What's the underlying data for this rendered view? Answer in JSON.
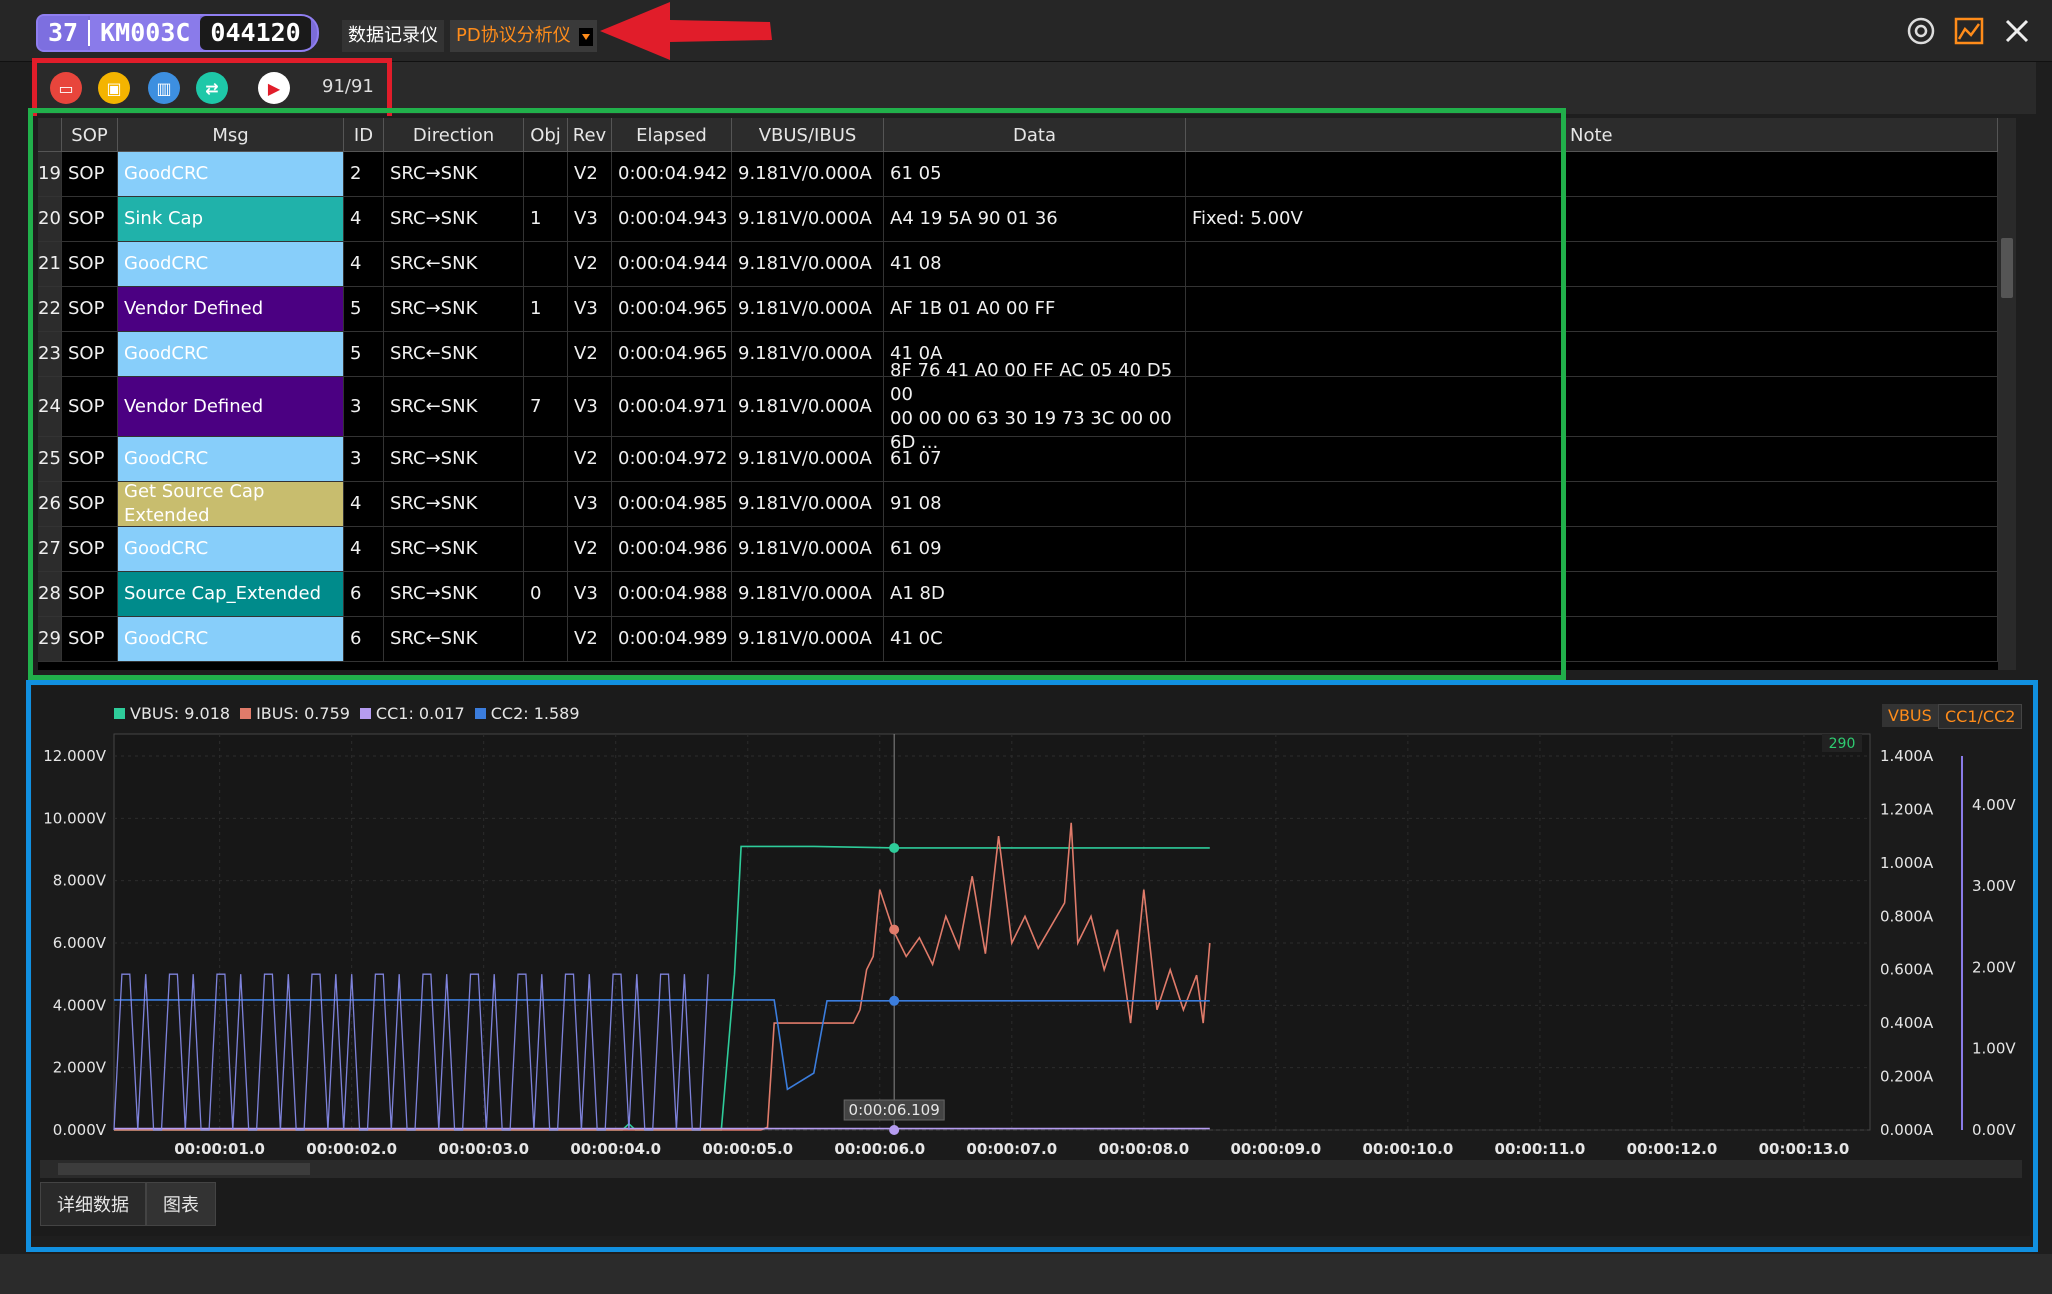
{
  "titlebar": {
    "device_num": "37",
    "device_model": "KM003C",
    "device_serial": "044120",
    "mode_tabs": [
      "数据记录仪",
      "PD协议分析仪"
    ],
    "active_mode": "PD协议分析仪"
  },
  "toolbar": {
    "buttons": [
      "open-folder-icon",
      "save-icon",
      "delete-icon",
      "sync-icon",
      "record-icon"
    ],
    "counter": "91/91"
  },
  "table": {
    "columns": [
      "SOP",
      "Msg",
      "ID",
      "Direction",
      "Obj",
      "Rev",
      "Elapsed",
      "VBUS/IBUS",
      "Data",
      "",
      "Note"
    ],
    "rows": [
      {
        "n": "19",
        "sop": "SOP",
        "msg": "GoodCRC",
        "msg_color": "#87cefa",
        "msg_text": "#ffffff",
        "id": "2",
        "dir": "SRC→SNK",
        "obj": "",
        "rev": "V2",
        "elapsed": "0:00:04.942",
        "vi": "9.181V/0.000A",
        "data": "61 05",
        "extra": "",
        "note": ""
      },
      {
        "n": "20",
        "sop": "SOP",
        "msg": "Sink Cap",
        "msg_color": "#20b2aa",
        "msg_text": "#ffffff",
        "id": "4",
        "dir": "SRC→SNK",
        "obj": "1",
        "rev": "V3",
        "elapsed": "0:00:04.943",
        "vi": "9.181V/0.000A",
        "data": "A4 19 5A 90 01 36",
        "extra": "Fixed: 5.00V",
        "note": ""
      },
      {
        "n": "21",
        "sop": "SOP",
        "msg": "GoodCRC",
        "msg_color": "#87cefa",
        "msg_text": "#ffffff",
        "id": "4",
        "dir": "SRC←SNK",
        "obj": "",
        "rev": "V2",
        "elapsed": "0:00:04.944",
        "vi": "9.181V/0.000A",
        "data": "41 08",
        "extra": "",
        "note": ""
      },
      {
        "n": "22",
        "sop": "SOP",
        "msg": "Vendor Defined",
        "msg_color": "#4b0082",
        "msg_text": "#ffffff",
        "id": "5",
        "dir": "SRC→SNK",
        "obj": "1",
        "rev": "V3",
        "elapsed": "0:00:04.965",
        "vi": "9.181V/0.000A",
        "data": "AF 1B 01 A0 00 FF",
        "extra": "",
        "note": ""
      },
      {
        "n": "23",
        "sop": "SOP",
        "msg": "GoodCRC",
        "msg_color": "#87cefa",
        "msg_text": "#ffffff",
        "id": "5",
        "dir": "SRC←SNK",
        "obj": "",
        "rev": "V2",
        "elapsed": "0:00:04.965",
        "vi": "9.181V/0.000A",
        "data": "41 0A",
        "extra": "",
        "note": ""
      },
      {
        "n": "24",
        "sop": "SOP",
        "msg": "Vendor Defined",
        "msg_color": "#4b0082",
        "msg_text": "#ffffff",
        "id": "3",
        "dir": "SRC←SNK",
        "obj": "7",
        "rev": "V3",
        "elapsed": "0:00:04.971",
        "vi": "9.181V/0.000A",
        "data": "8F 76 41 A0 00 FF AC 05 40 D5 00\n00 00 00 63 30 19 73 3C 00 00 6D ...",
        "extra": "",
        "note": ""
      },
      {
        "n": "25",
        "sop": "SOP",
        "msg": "GoodCRC",
        "msg_color": "#87cefa",
        "msg_text": "#ffffff",
        "id": "3",
        "dir": "SRC→SNK",
        "obj": "",
        "rev": "V2",
        "elapsed": "0:00:04.972",
        "vi": "9.181V/0.000A",
        "data": "61 07",
        "extra": "",
        "note": ""
      },
      {
        "n": "26",
        "sop": "SOP",
        "msg": "Get Source Cap Extended",
        "msg_color": "#c8bd6e",
        "msg_text": "#ffffff",
        "id": "4",
        "dir": "SRC→SNK",
        "obj": "",
        "rev": "V3",
        "elapsed": "0:00:04.985",
        "vi": "9.181V/0.000A",
        "data": "91 08",
        "extra": "",
        "note": ""
      },
      {
        "n": "27",
        "sop": "SOP",
        "msg": "GoodCRC",
        "msg_color": "#87cefa",
        "msg_text": "#ffffff",
        "id": "4",
        "dir": "SRC→SNK",
        "obj": "",
        "rev": "V2",
        "elapsed": "0:00:04.986",
        "vi": "9.181V/0.000A",
        "data": "61 09",
        "extra": "",
        "note": ""
      },
      {
        "n": "28",
        "sop": "SOP",
        "msg": "Source Cap_Extended",
        "msg_color": "#008b8b",
        "msg_text": "#ffffff",
        "id": "6",
        "dir": "SRC→SNK",
        "obj": "0",
        "rev": "V3",
        "elapsed": "0:00:04.988",
        "vi": "9.181V/0.000A",
        "data": "A1 8D",
        "extra": "",
        "note": ""
      },
      {
        "n": "29",
        "sop": "SOP",
        "msg": "GoodCRC",
        "msg_color": "#87cefa",
        "msg_text": "#ffffff",
        "id": "6",
        "dir": "SRC←SNK",
        "obj": "",
        "rev": "V2",
        "elapsed": "0:00:04.989",
        "vi": "9.181V/0.000A",
        "data": "41 0C",
        "extra": "",
        "note": ""
      }
    ]
  },
  "chart": {
    "legend": [
      {
        "name": "VBUS: 9.018",
        "color": "#2ecc9a"
      },
      {
        "name": "IBUS: 0.759",
        "color": "#e07b6a"
      },
      {
        "name": "CC1: 0.017",
        "color": "#b59cf0"
      },
      {
        "name": "CC2: 1.589",
        "color": "#3b7ddd"
      }
    ],
    "right_tabs": [
      "VBUS",
      "CC1/CC2"
    ],
    "badge": "290",
    "cursor_label": "0:00:06.109",
    "panel_title": "图表"
  },
  "chart_data": {
    "type": "line",
    "x_ticks": [
      "00:00:01.0",
      "00:00:02.0",
      "00:00:03.0",
      "00:00:04.0",
      "00:00:05.0",
      "00:00:06.0",
      "00:00:07.0",
      "00:00:08.0",
      "00:00:09.0",
      "00:00:10.0",
      "00:00:11.0",
      "00:00:12.0",
      "00:00:13.0"
    ],
    "y_left_ticks": [
      "12.000V",
      "10.000V",
      "8.000V",
      "6.000V",
      "4.000V",
      "2.000V",
      "0.000V"
    ],
    "y_right_ticks": [
      "1.400A",
      "1.200A",
      "1.000A",
      "0.800A",
      "0.600A",
      "0.400A",
      "0.200A",
      "0.000A"
    ],
    "y_cc_ticks": [
      "4.00V",
      "3.00V",
      "2.00V",
      "1.00V",
      "0.00V"
    ],
    "xlim": [
      0.2,
      13.5
    ],
    "series": [
      {
        "name": "VBUS",
        "unit": "V",
        "axis": "left",
        "points": [
          [
            0.0,
            0
          ],
          [
            4.05,
            0
          ],
          [
            4.1,
            0.2
          ],
          [
            4.15,
            0
          ],
          [
            4.8,
            0
          ],
          [
            4.9,
            5.0
          ],
          [
            4.95,
            9.1
          ],
          [
            5.5,
            9.1
          ],
          [
            6.1,
            9.05
          ],
          [
            7.0,
            9.05
          ],
          [
            8.0,
            9.05
          ],
          [
            8.5,
            9.05
          ]
        ]
      },
      {
        "name": "IBUS",
        "unit": "A",
        "axis": "right",
        "points": [
          [
            0.0,
            0
          ],
          [
            5.1,
            0
          ],
          [
            5.15,
            0.01
          ],
          [
            5.2,
            0.4
          ],
          [
            5.8,
            0.4
          ],
          [
            5.85,
            0.45
          ],
          [
            5.9,
            0.6
          ],
          [
            5.95,
            0.65
          ],
          [
            6.0,
            0.9
          ],
          [
            6.1,
            0.75
          ],
          [
            6.2,
            0.65
          ],
          [
            6.3,
            0.72
          ],
          [
            6.4,
            0.62
          ],
          [
            6.5,
            0.8
          ],
          [
            6.6,
            0.68
          ],
          [
            6.7,
            0.95
          ],
          [
            6.8,
            0.66
          ],
          [
            6.9,
            1.1
          ],
          [
            7.0,
            0.7
          ],
          [
            7.1,
            0.8
          ],
          [
            7.2,
            0.68
          ],
          [
            7.4,
            0.85
          ],
          [
            7.45,
            1.15
          ],
          [
            7.5,
            0.7
          ],
          [
            7.6,
            0.8
          ],
          [
            7.7,
            0.6
          ],
          [
            7.8,
            0.75
          ],
          [
            7.9,
            0.4
          ],
          [
            8.0,
            0.9
          ],
          [
            8.1,
            0.45
          ],
          [
            8.2,
            0.6
          ],
          [
            8.3,
            0.45
          ],
          [
            8.4,
            0.58
          ],
          [
            8.45,
            0.4
          ],
          [
            8.5,
            0.7
          ]
        ]
      },
      {
        "name": "CC1",
        "unit": "V",
        "axis": "cc",
        "points": [
          [
            0.0,
            0.017
          ],
          [
            8.5,
            0.017
          ]
        ]
      },
      {
        "name": "CC2",
        "unit": "V",
        "axis": "cc",
        "points": [
          [
            0.0,
            1.6
          ],
          [
            5.2,
            1.6
          ],
          [
            5.3,
            0.5
          ],
          [
            5.5,
            0.7
          ],
          [
            5.6,
            1.589
          ],
          [
            8.5,
            1.589
          ]
        ]
      }
    ],
    "cursor_x": 6.109
  },
  "bottom_tabs": [
    "详细数据",
    "图表"
  ]
}
